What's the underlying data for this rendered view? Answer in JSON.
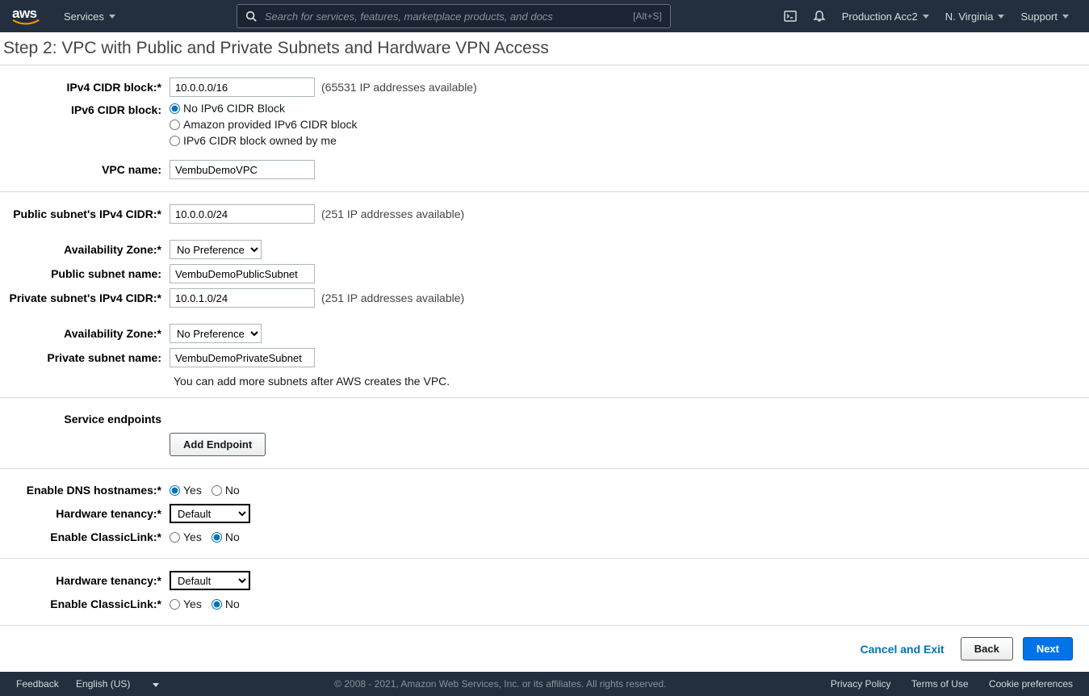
{
  "nav": {
    "services": "Services",
    "search_placeholder": "Search for services, features, marketplace products, and docs",
    "shortcut": "[Alt+S]",
    "account": "Production Acc2",
    "region": "N. Virginia",
    "support": "Support"
  },
  "page": {
    "title": "Step 2: VPC with Public and Private Subnets and Hardware VPN Access"
  },
  "form": {
    "ipv4_cidr_label": "IPv4 CIDR block:*",
    "ipv4_cidr_value": "10.0.0.0/16",
    "ipv4_cidr_hint": "(65531 IP addresses available)",
    "ipv6_cidr_label": "IPv6 CIDR block:",
    "ipv6_opt1": "No IPv6 CIDR Block",
    "ipv6_opt2": "Amazon provided IPv6 CIDR block",
    "ipv6_opt3": "IPv6 CIDR block owned by me",
    "vpc_name_label": "VPC name:",
    "vpc_name_value": "VembuDemoVPC",
    "pub_cidr_label": "Public subnet's IPv4 CIDR:*",
    "pub_cidr_value": "10.0.0.0/24",
    "pub_cidr_hint": "(251 IP addresses available)",
    "az_label": "Availability Zone:*",
    "az_value": "No Preference",
    "pub_name_label": "Public subnet name:",
    "pub_name_value": "VembuDemoPublicSubnet",
    "priv_cidr_label": "Private subnet's IPv4 CIDR:*",
    "priv_cidr_value": "10.0.1.0/24",
    "priv_cidr_hint": "(251 IP addresses available)",
    "priv_name_label": "Private subnet name:",
    "priv_name_value": "VembuDemoPrivateSubnet",
    "more_subnets_hint": "You can add more subnets after AWS creates the VPC.",
    "service_endpoints_label": "Service endpoints",
    "add_endpoint_btn": "Add Endpoint",
    "dns_label": "Enable DNS hostnames:*",
    "yes": "Yes",
    "no": "No",
    "tenancy_label": "Hardware tenancy:*",
    "tenancy_value": "Default",
    "classiclink_label": "Enable ClassicLink:*"
  },
  "buttons": {
    "cancel": "Cancel and Exit",
    "back": "Back",
    "next": "Next"
  },
  "footer": {
    "feedback": "Feedback",
    "language": "English (US)",
    "copyright": "© 2008 - 2021, Amazon Web Services, Inc. or its affiliates. All rights reserved.",
    "privacy": "Privacy Policy",
    "terms": "Terms of Use",
    "cookies": "Cookie preferences"
  }
}
